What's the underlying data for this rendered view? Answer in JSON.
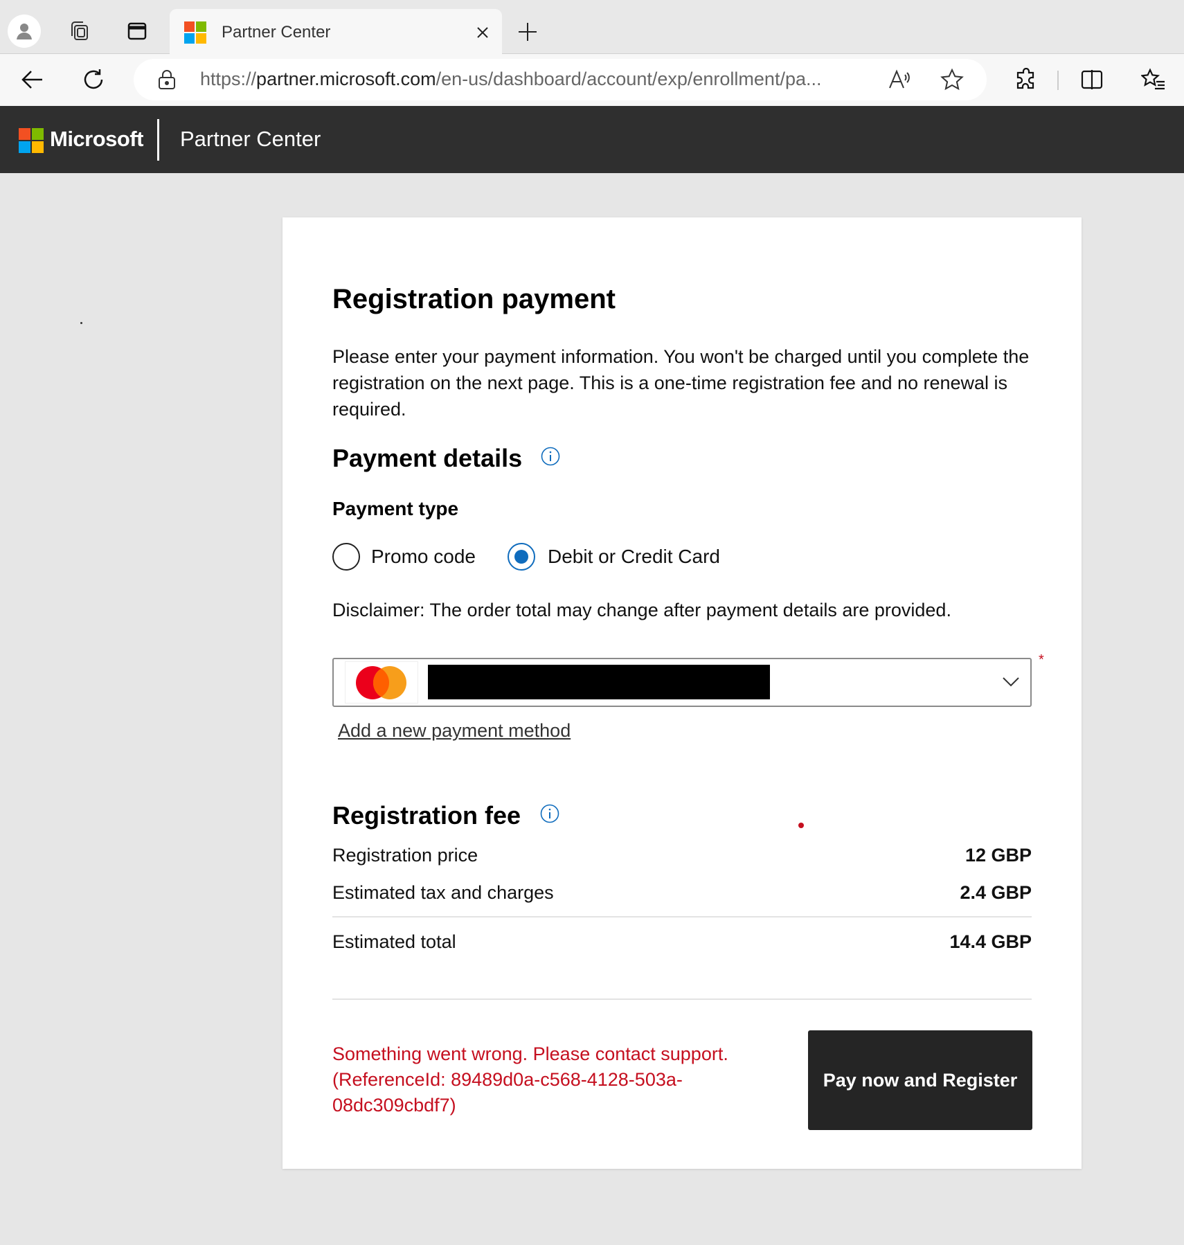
{
  "browser": {
    "tab_title": "Partner Center",
    "url_scheme": "https://",
    "url_domain": "partner.microsoft.com",
    "url_path": "/en-us/dashboard/account/exp/enrollment/pa..."
  },
  "header": {
    "brand": "Microsoft",
    "product": "Partner Center"
  },
  "page": {
    "title": "Registration payment",
    "intro": "Please enter your payment information. You won't be charged until you complete the registration on the next page. This is a one-time registration fee and no renewal is required.",
    "payment_details_heading": "Payment details",
    "payment_type_label": "Payment type",
    "payment_options": [
      {
        "label": "Promo code",
        "selected": false
      },
      {
        "label": "Debit or Credit Card",
        "selected": true
      }
    ],
    "disclaimer": "Disclaimer: The order total may change after payment details are provided.",
    "required_mark": "*",
    "add_payment_link": "Add a new payment method",
    "fee_heading": "Registration fee",
    "fees": [
      {
        "label": "Registration price",
        "value": "12 GBP"
      },
      {
        "label": "Estimated tax and charges",
        "value": "2.4 GBP"
      }
    ],
    "total": {
      "label": "Estimated total",
      "value": "14.4 GBP"
    },
    "error_message": "Something went wrong. Please contact support. (ReferenceId: 89489d0a-c568-4128-503a-08dc309cbdf7)",
    "pay_button": "Pay now and Register"
  },
  "colors": {
    "accent": "#0f6cbd",
    "error": "#c50f1f",
    "header_bg": "#2f2f2f",
    "button_bg": "#252525"
  },
  "icons": [
    "profile-icon",
    "collections-icon",
    "tab-actions-icon",
    "close-icon",
    "plus-icon",
    "back-icon",
    "refresh-icon",
    "lock-icon",
    "read-aloud-icon",
    "star-icon",
    "extensions-icon",
    "split-screen-icon",
    "favorites-icon",
    "info-icon",
    "chevron-down-icon",
    "mastercard-icon"
  ]
}
